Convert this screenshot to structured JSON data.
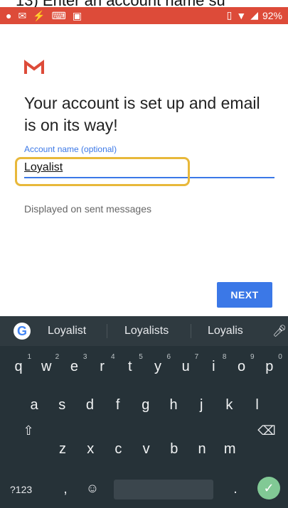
{
  "caption": "13) Enter an account name su",
  "status": {
    "battery": "92%",
    "icons_left": [
      "app-icon",
      "gmail-icon",
      "charging-icon",
      "keyboard-icon",
      "image-icon"
    ],
    "icons_right": [
      "vibrate-icon",
      "wifi-icon",
      "signal-icon"
    ]
  },
  "headline": "Your account is set up and email is on its way!",
  "field": {
    "label": "Account name (optional)",
    "value": "Loyalist"
  },
  "helper": "Displayed on sent messages",
  "next_label": "NEXT",
  "keyboard": {
    "suggestions": [
      "Loyalist",
      "Loyalists",
      "Loyalis"
    ],
    "row1": [
      "q",
      "w",
      "e",
      "r",
      "t",
      "y",
      "u",
      "i",
      "o",
      "p"
    ],
    "row1_hints": [
      "1",
      "2",
      "3",
      "4",
      "5",
      "6",
      "7",
      "8",
      "9",
      "0"
    ],
    "row2": [
      "a",
      "s",
      "d",
      "f",
      "g",
      "h",
      "j",
      "k",
      "l"
    ],
    "row3": [
      "z",
      "x",
      "c",
      "v",
      "b",
      "n",
      "m"
    ],
    "sym_label": "?123",
    "comma": ",",
    "period": "."
  },
  "colors": {
    "status_bar": "#dd4b39",
    "accent": "#3b78e7",
    "highlight": "#e8b83a",
    "keyboard_bg": "#263238",
    "enter": "#81c995"
  }
}
